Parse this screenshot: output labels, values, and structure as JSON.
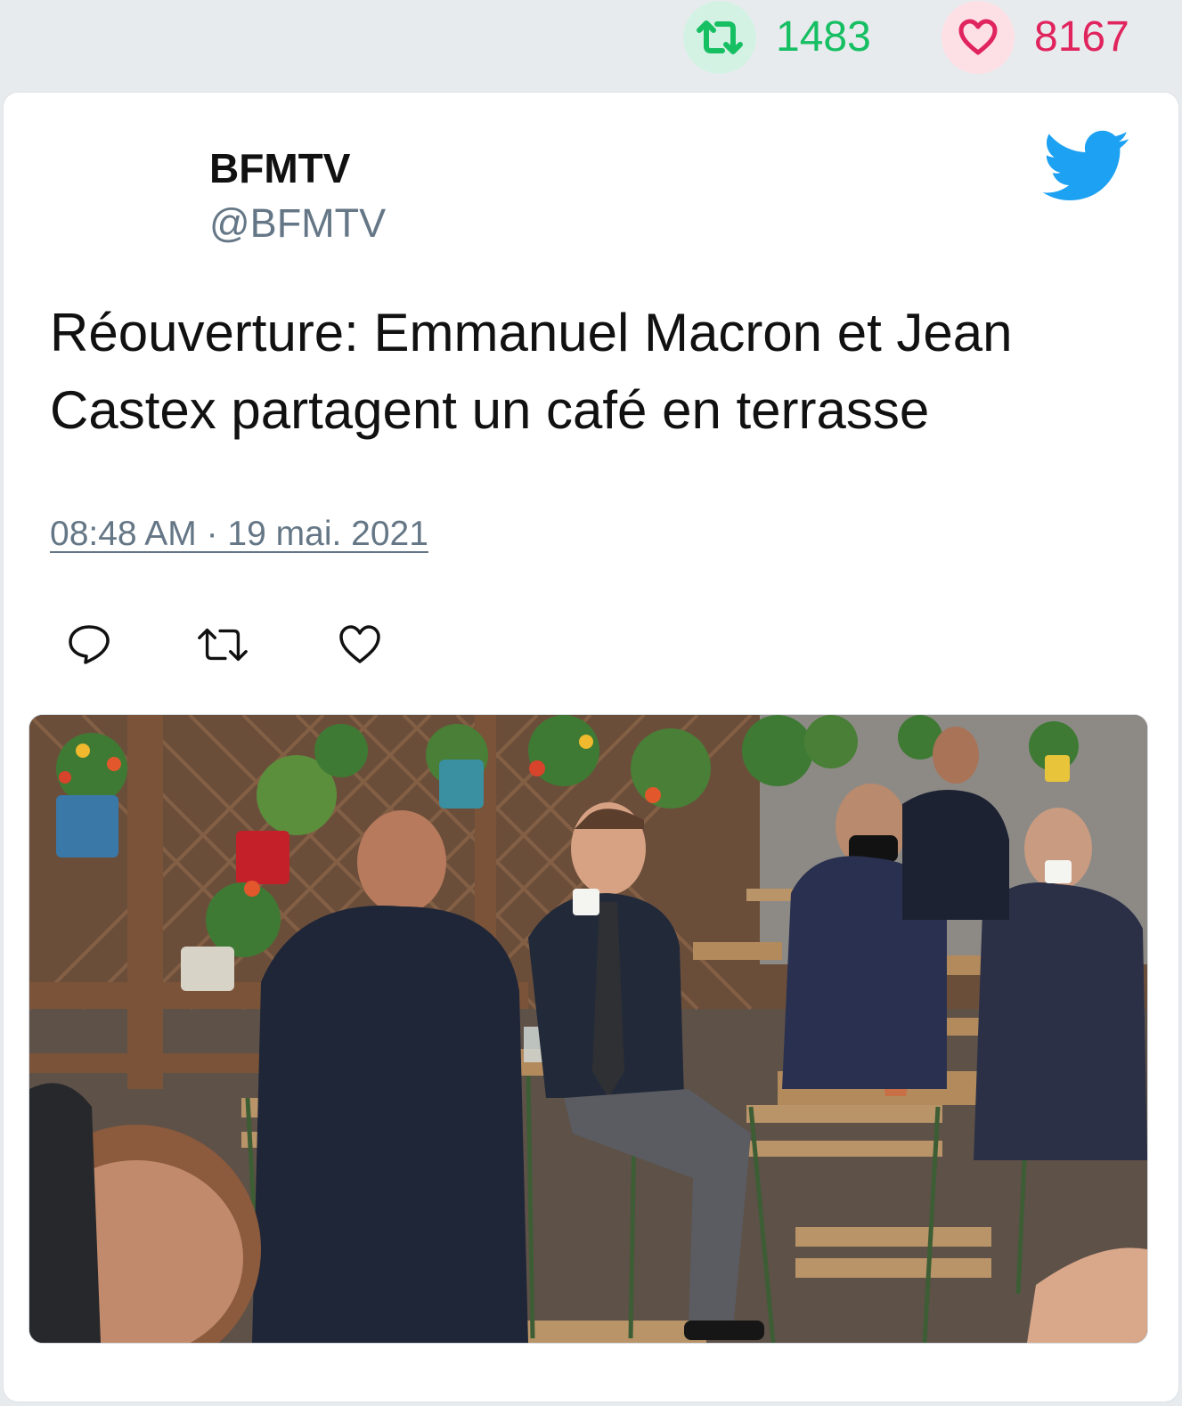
{
  "stats": {
    "retweets": "1483",
    "likes": "8167"
  },
  "tweet": {
    "author_name": "BFMTV",
    "author_handle": "@BFMTV",
    "text": "Réouverture: Emmanuel Macron et Jean Castex partagent un café en terrasse",
    "timestamp": "08:48 AM · 19 mai. 2021"
  },
  "icons": {
    "brand": "twitter-bird-icon",
    "stats": [
      "retweet-icon",
      "heart-icon"
    ],
    "actions": [
      "reply-icon",
      "retweet-icon",
      "like-icon"
    ]
  },
  "colors": {
    "retweet_green": "#17bf63",
    "like_pink": "#e0245e",
    "twitter_blue": "#1da1f2",
    "handle_gray": "#657786"
  }
}
